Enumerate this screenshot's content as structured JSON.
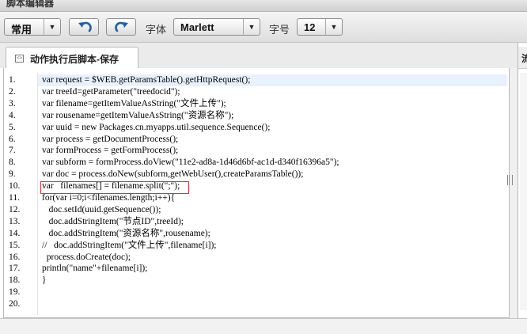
{
  "window": {
    "title": "脚本编辑器"
  },
  "toolbar": {
    "style_select": {
      "value": "常用"
    },
    "undo_icon": "undo-arrow-icon",
    "redo_icon": "redo-arrow-icon",
    "font_label": "字体",
    "font_select": {
      "value": "Marlett"
    },
    "size_label": "字号",
    "size_select": {
      "value": "12"
    },
    "accent_color": "#1e5fa8"
  },
  "tab": {
    "icon": "script-icon",
    "label": "动作执行后脚本-保存"
  },
  "right_panel": {
    "header": "流"
  },
  "editor": {
    "highlight_color": "#e8f2fe",
    "marker_color": "#e03030",
    "lines": [
      {
        "num": "1.",
        "code": "var request = $WEB.getParamsTable().getHttpRequest();"
      },
      {
        "num": "2.",
        "code": "var treeId=getParameter(\"treedocid\");"
      },
      {
        "num": "3.",
        "code": "var filename=getItemValueAsString(\"文件上传\");"
      },
      {
        "num": "4.",
        "code": "var rousename=getItemValueAsString(\"资源名称\");"
      },
      {
        "num": "5.",
        "code": "var uuid = new Packages.cn.myapps.util.sequence.Sequence();"
      },
      {
        "num": "6.",
        "code": "var process = getDocumentProcess();"
      },
      {
        "num": "7.",
        "code": "var formProcess = getFormProcess();"
      },
      {
        "num": "8.",
        "code": "var subform = formProcess.doView(\"11e2-ad8a-1d46d6bf-ac1d-d340f16396a5\");"
      },
      {
        "num": "9.",
        "code": "var doc = process.doNew(subform,getWebUser(),createParamsTable());"
      },
      {
        "num": "10.",
        "code": "var   filenames[] = filename.split(\";\");"
      },
      {
        "num": "11.",
        "code": "for(var i=0;i<filenames.length;i++){"
      },
      {
        "num": "12.",
        "code": "   doc.setId(uuid.getSequence());"
      },
      {
        "num": "13.",
        "code": "   doc.addStringItem(\"节点ID\",treeId);"
      },
      {
        "num": "14.",
        "code": "   doc.addStringItem(\"资源名称\",rousename);"
      },
      {
        "num": "15.",
        "code": "//   doc.addStringItem(\"文件上传\",filename[i]);"
      },
      {
        "num": "16.",
        "code": "  process.doCreate(doc);"
      },
      {
        "num": "17.",
        "code": "println(\"name\"+filename[i]);"
      },
      {
        "num": "18.",
        "code": "}"
      },
      {
        "num": "19.",
        "code": ""
      },
      {
        "num": "20.",
        "code": ""
      }
    ]
  }
}
